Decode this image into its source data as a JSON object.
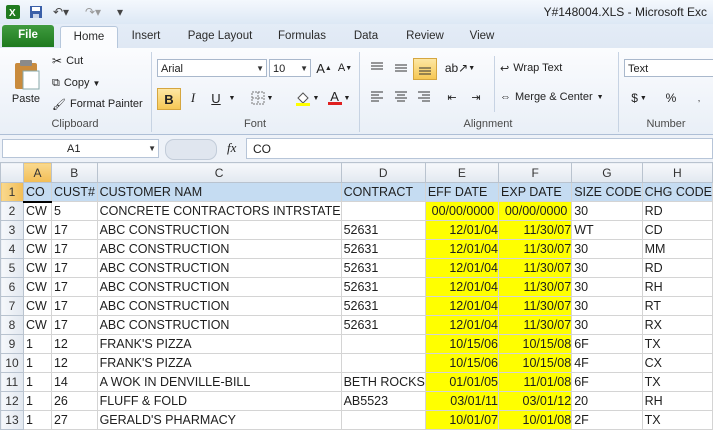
{
  "window": {
    "title": "Y#148004.XLS - Microsoft Exc"
  },
  "tabs": [
    "File",
    "Home",
    "Insert",
    "Page Layout",
    "Formulas",
    "Data",
    "Review",
    "View"
  ],
  "ribbon": {
    "clipboard": {
      "label": "Clipboard",
      "paste": "Paste",
      "cut": "Cut",
      "copy": "Copy",
      "format_painter": "Format Painter"
    },
    "font": {
      "label": "Font",
      "name": "Arial",
      "size": "10",
      "bold": "B",
      "italic": "I",
      "underline": "U",
      "font_color_letter": "A"
    },
    "alignment": {
      "label": "Alignment",
      "wrap_text": "Wrap Text",
      "merge_center": "Merge & Center"
    },
    "number": {
      "label": "Number",
      "format": "Text",
      "currency": "$",
      "percent": "%"
    }
  },
  "formula_bar": {
    "name_box": "A1",
    "fx": "fx",
    "value": "CO"
  },
  "columns": [
    "A",
    "B",
    "C",
    "D",
    "E",
    "F",
    "G",
    "H"
  ],
  "rows": [
    {
      "n": "1",
      "cells": [
        "CO",
        "CUST#",
        "CUSTOMER NAM",
        "CONTRACT",
        "EFF DATE",
        "EXP DATE",
        "SIZE CODE",
        "CHG CODE"
      ]
    },
    {
      "n": "2",
      "cells": [
        "CW",
        "5",
        "CONCRETE CONTRACTORS INTRSTATE",
        "",
        "00/00/0000",
        "00/00/0000",
        "30",
        "RD"
      ]
    },
    {
      "n": "3",
      "cells": [
        "CW",
        "17",
        "ABC CONSTRUCTION",
        "52631",
        "12/01/04",
        "11/30/07",
        "WT",
        "CD"
      ]
    },
    {
      "n": "4",
      "cells": [
        "CW",
        "17",
        "ABC CONSTRUCTION",
        "52631",
        "12/01/04",
        "11/30/07",
        "30",
        "MM"
      ]
    },
    {
      "n": "5",
      "cells": [
        "CW",
        "17",
        "ABC CONSTRUCTION",
        "52631",
        "12/01/04",
        "11/30/07",
        "30",
        "RD"
      ]
    },
    {
      "n": "6",
      "cells": [
        "CW",
        "17",
        "ABC CONSTRUCTION",
        "52631",
        "12/01/04",
        "11/30/07",
        "30",
        "RH"
      ]
    },
    {
      "n": "7",
      "cells": [
        "CW",
        "17",
        "ABC CONSTRUCTION",
        "52631",
        "12/01/04",
        "11/30/07",
        "30",
        "RT"
      ]
    },
    {
      "n": "8",
      "cells": [
        "CW",
        "17",
        "ABC CONSTRUCTION",
        "52631",
        "12/01/04",
        "11/30/07",
        "30",
        "RX"
      ]
    },
    {
      "n": "9",
      "cells": [
        "1",
        "12",
        "FRANK'S PIZZA",
        "",
        "10/15/06",
        "10/15/08",
        "6F",
        "TX"
      ]
    },
    {
      "n": "10",
      "cells": [
        "1",
        "12",
        "FRANK'S PIZZA",
        "",
        "10/15/06",
        "10/15/08",
        "4F",
        "CX"
      ]
    },
    {
      "n": "11",
      "cells": [
        "1",
        "14",
        "A WOK IN DENVILLE-BILL",
        "BETH ROCKS",
        "01/01/05",
        "11/01/08",
        "6F",
        "TX"
      ]
    },
    {
      "n": "12",
      "cells": [
        "1",
        "26",
        "FLUFF & FOLD",
        "AB5523",
        "03/01/11",
        "03/01/12",
        "20",
        "RH"
      ]
    },
    {
      "n": "13",
      "cells": [
        "1",
        "27",
        "GERALD'S PHARMACY",
        "",
        "10/01/07",
        "10/01/08",
        "2F",
        "TX"
      ]
    }
  ],
  "colors": {
    "highlight": "#ffff00",
    "header_row": "#c5dcf2",
    "selected_header": "#f2bd55",
    "file_tab": "#2a8a2a"
  }
}
